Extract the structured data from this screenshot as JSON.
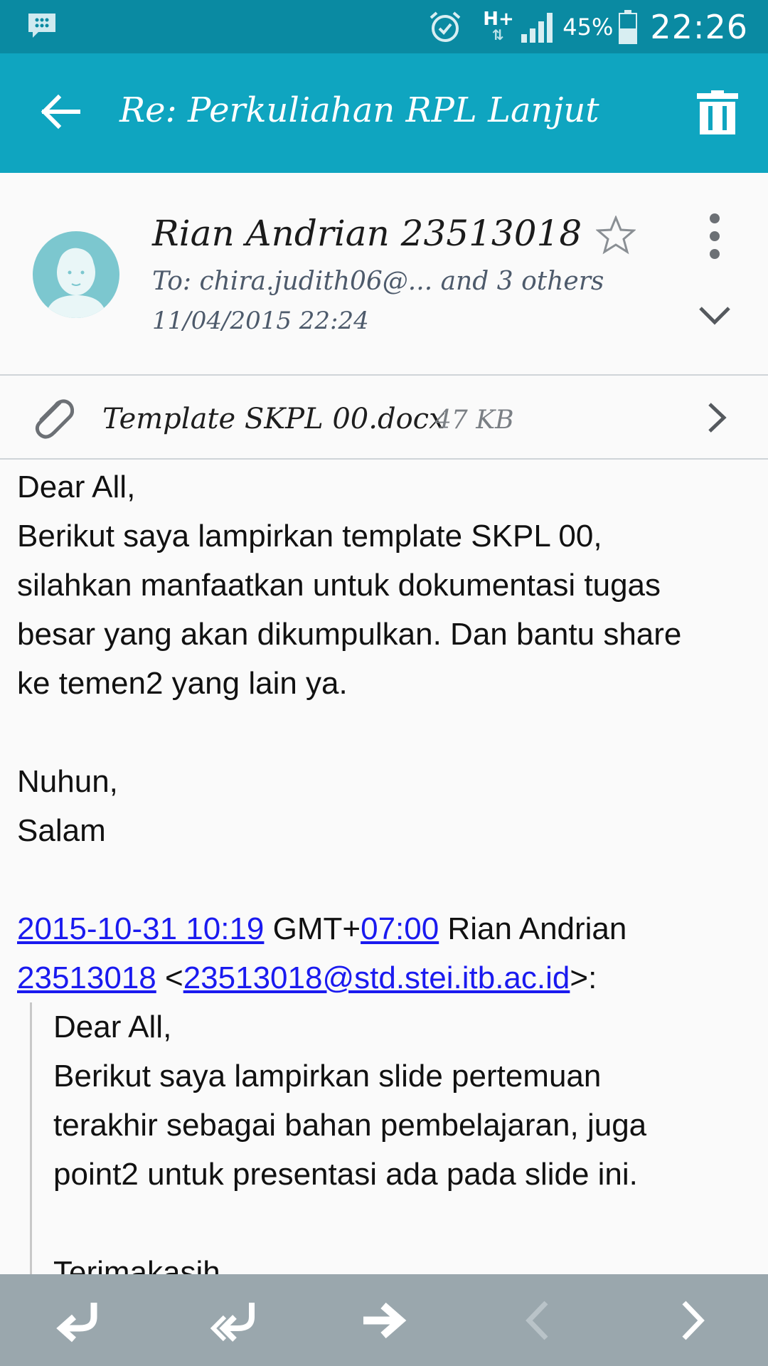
{
  "status_bar": {
    "network_label": "H+",
    "battery_percent": "45%",
    "time": "22:26"
  },
  "app_bar": {
    "title": "Re: Perkuliahan RPL Lanjut"
  },
  "message_header": {
    "sender": "Rian Andrian 23513018",
    "to": "To: chira.judith06@... and 3 others",
    "date": "11/04/2015  22:24"
  },
  "attachment": {
    "filename": "Template SKPL 00.docx",
    "size": "47 KB"
  },
  "body": {
    "greeting": "Dear All,",
    "paragraph_lines": [
      "Berikut saya lampirkan template SKPL 00,",
      "silahkan manfaatkan untuk dokumentasi tugas",
      "besar yang akan dikumpulkan. Dan bantu share",
      "ke temen2 yang lain ya."
    ],
    "signoff_1": "Nuhun,",
    "signoff_2": "Salam",
    "quote_header": {
      "date_link": "2015-10-31 10:19",
      "gmt_text": " GMT+",
      "offset_link": "07:00",
      "name_text": " Rian Andrian",
      "id_link": "23513018",
      "lt": " <",
      "email_link": "23513018@std.stei.itb.ac.id",
      "gt": ">:"
    },
    "quoted": {
      "greeting": "Dear All,",
      "lines": [
        "Berikut saya lampirkan slide pertemuan",
        "terakhir sebagai bahan pembelajaran, juga",
        "point2 untuk presentasi ada pada slide ini."
      ],
      "closing": "Terimakasih"
    }
  },
  "bottom_bar": {
    "icons": [
      "reply-icon",
      "reply-all-icon",
      "forward-icon",
      "previous-icon",
      "next-icon"
    ]
  }
}
